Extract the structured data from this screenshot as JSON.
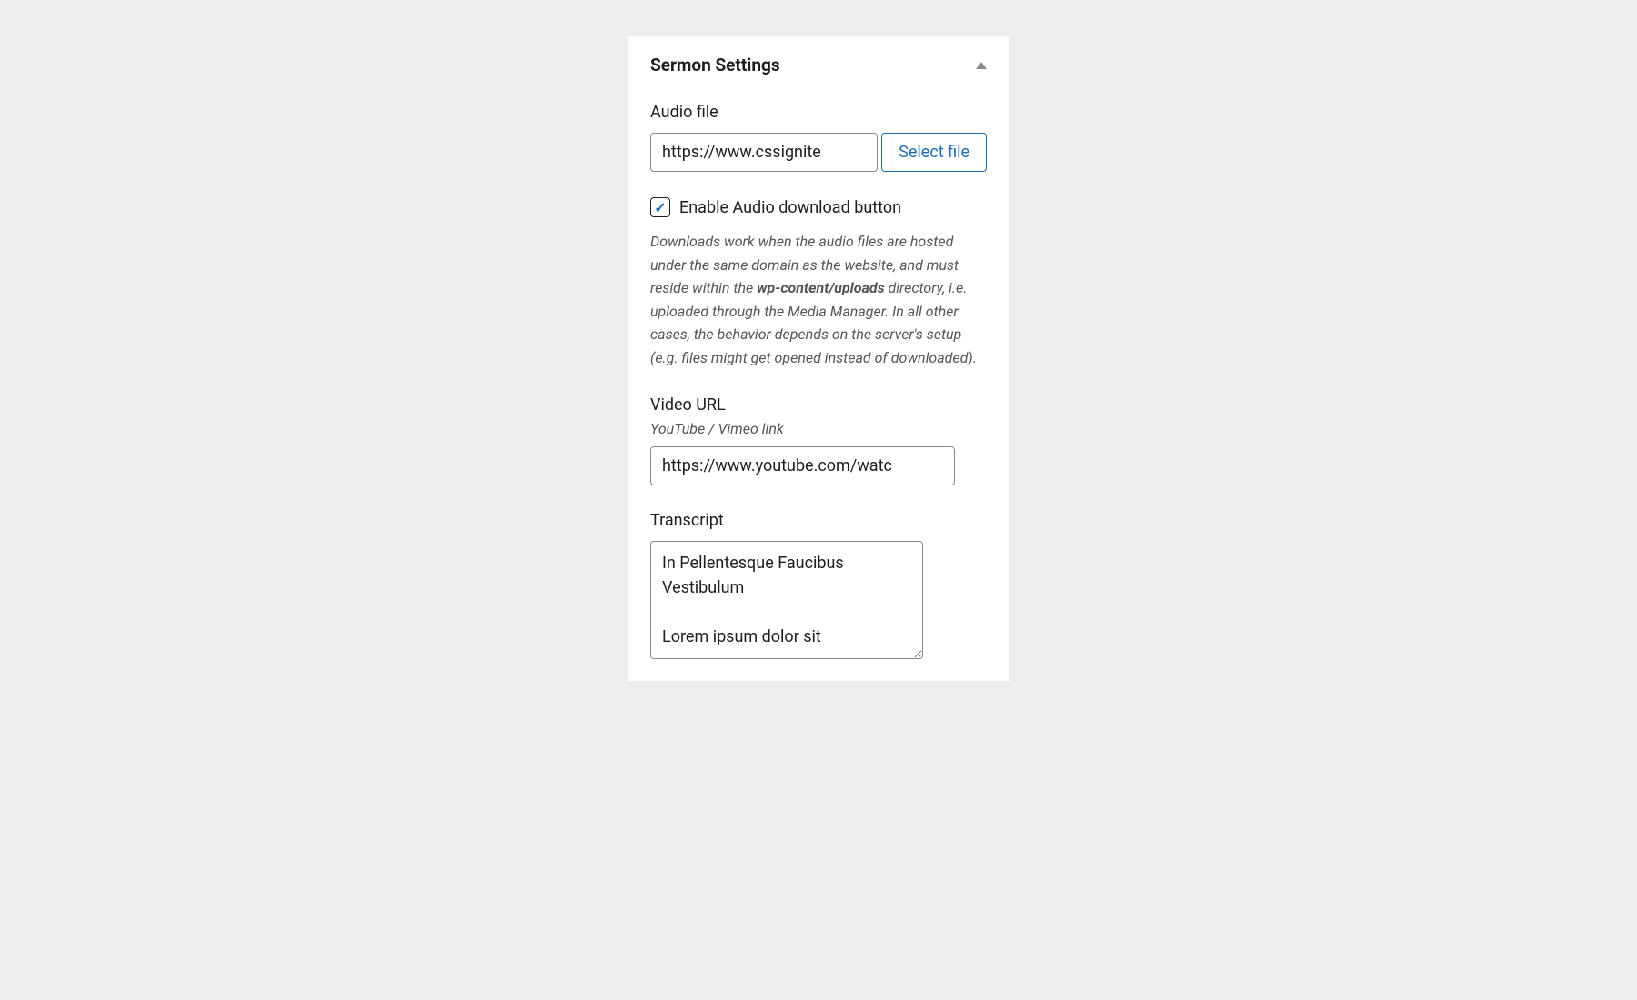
{
  "panel": {
    "title": "Sermon Settings"
  },
  "audio": {
    "label": "Audio file",
    "value": "https://www.cssignite",
    "select_button": "Select file"
  },
  "download": {
    "checkbox_label": "Enable Audio download button",
    "checked": true,
    "help_prefix": "Downloads work when the audio files are hosted under the same domain as the website, and must reside within the ",
    "help_bold": "wp-content/uploads",
    "help_suffix": " directory, i.e. uploaded through the Media Manager. In all other cases, the behavior depends on the server's setup (e.g. files might get opened instead of downloaded)."
  },
  "video": {
    "label": "Video URL",
    "sublabel": "YouTube / Vimeo link",
    "value": "https://www.youtube.com/watc"
  },
  "transcript": {
    "label": "Transcript",
    "value": "In Pellentesque Faucibus Vestibulum\n\nLorem ipsum dolor sit"
  }
}
